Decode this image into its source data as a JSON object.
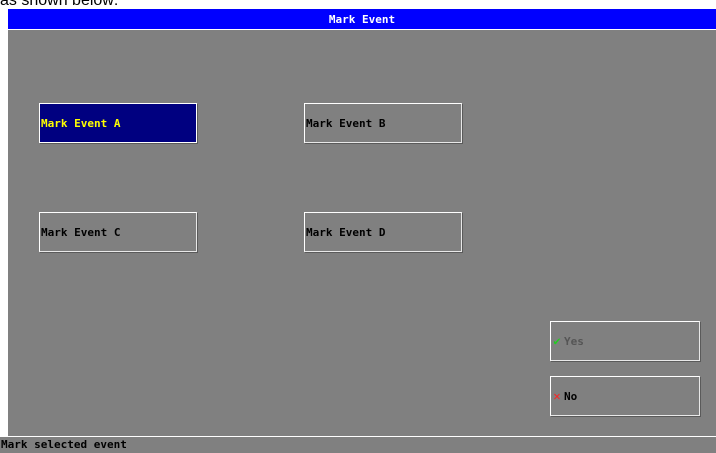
{
  "caption": "as shown below:",
  "dialog": {
    "title": "Mark Event"
  },
  "events": [
    {
      "label": "Mark Event A",
      "selected": true
    },
    {
      "label": "Mark Event B",
      "selected": false
    },
    {
      "label": "Mark Event C",
      "selected": false
    },
    {
      "label": "Mark Event D",
      "selected": false
    }
  ],
  "actions": {
    "yes_label": "Yes",
    "no_label": "No",
    "yes_icon": "check-icon",
    "no_icon": "x-icon"
  },
  "colors": {
    "title_bar": "#0000ff",
    "background": "#808080",
    "selected_button": "#000080",
    "selected_text": "#ffff00",
    "check": "#22cc22",
    "cross": "#ff2020"
  },
  "status": {
    "text": "Mark selected event"
  }
}
